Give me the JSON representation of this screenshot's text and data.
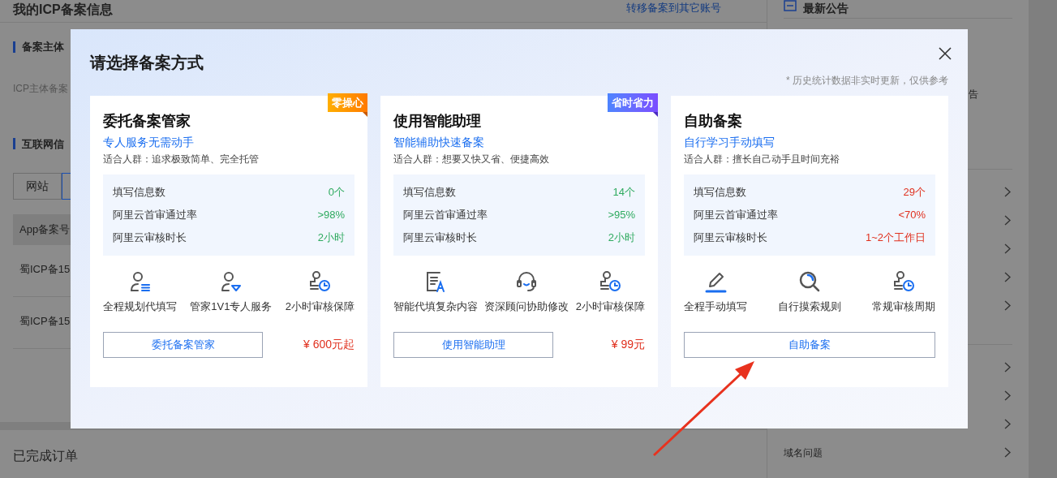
{
  "background": {
    "page_title": "我的ICP备案信息",
    "transfer_link": "转移备案到其它账号",
    "section_1": "备案主体",
    "field_label": "ICP主体备案",
    "section_2": "互联网信",
    "tabs": [
      {
        "label": "网站",
        "selected": false
      },
      {
        "selected": true
      }
    ],
    "table_header": "App备案号",
    "rows": [
      "蜀ICP备15",
      "蜀ICP备15"
    ],
    "completed_orders": "已完成订单"
  },
  "side_panel": {
    "heading": "最新公告",
    "fragment": "告",
    "faq_item": "域名问题"
  },
  "dialog": {
    "title": "请选择备案方式",
    "note": "* 历史统计数据非实时更新，仅供参考",
    "cards": [
      {
        "badge": {
          "text": "零操心",
          "kind": "orange"
        },
        "title": "委托备案管家",
        "subtitle": "专人服务无需动手",
        "audience": "适合人群：追求极致简单、完全托管",
        "stats": [
          {
            "label": "填写信息数",
            "value": "0个",
            "color": "#2eaa5f"
          },
          {
            "label": "阿里云首审通过率",
            "value": ">98%",
            "color": "#2eaa5f"
          },
          {
            "label": "阿里云审核时长",
            "value": "2小时",
            "color": "#2eaa5f"
          }
        ],
        "features": [
          "全程规划代填写",
          "管家1V1专人服务",
          "2小时审核保障"
        ],
        "button": "委托备案管家",
        "price": "¥ 600元起"
      },
      {
        "badge": {
          "text": "省时省力",
          "kind": "purple"
        },
        "title": "使用智能助理",
        "subtitle": "智能辅助快速备案",
        "audience": "适合人群：想要又快又省、便捷高效",
        "stats": [
          {
            "label": "填写信息数",
            "value": "14个",
            "color": "#2eaa5f"
          },
          {
            "label": "阿里云首审通过率",
            "value": ">95%",
            "color": "#2eaa5f"
          },
          {
            "label": "阿里云审核时长",
            "value": "2小时",
            "color": "#2eaa5f"
          }
        ],
        "features": [
          "智能代填复杂内容",
          "资深顾问协助修改",
          "2小时审核保障"
        ],
        "button": "使用智能助理",
        "price": "¥ 99元"
      },
      {
        "title": "自助备案",
        "subtitle": "自行学习手动填写",
        "audience": "适合人群：擅长自己动手且时间充裕",
        "stats": [
          {
            "label": "填写信息数",
            "value": "29个",
            "color": "#e0301e"
          },
          {
            "label": "阿里云首审通过率",
            "value": "<70%",
            "color": "#e0301e"
          },
          {
            "label": "阿里云审核时长",
            "value": "1~2个工作日",
            "color": "#e0301e"
          }
        ],
        "features": [
          "全程手动填写",
          "自行摸索规则",
          "常规审核周期"
        ],
        "button": "自助备案"
      }
    ]
  },
  "annotation": {
    "kind": "arrow"
  }
}
